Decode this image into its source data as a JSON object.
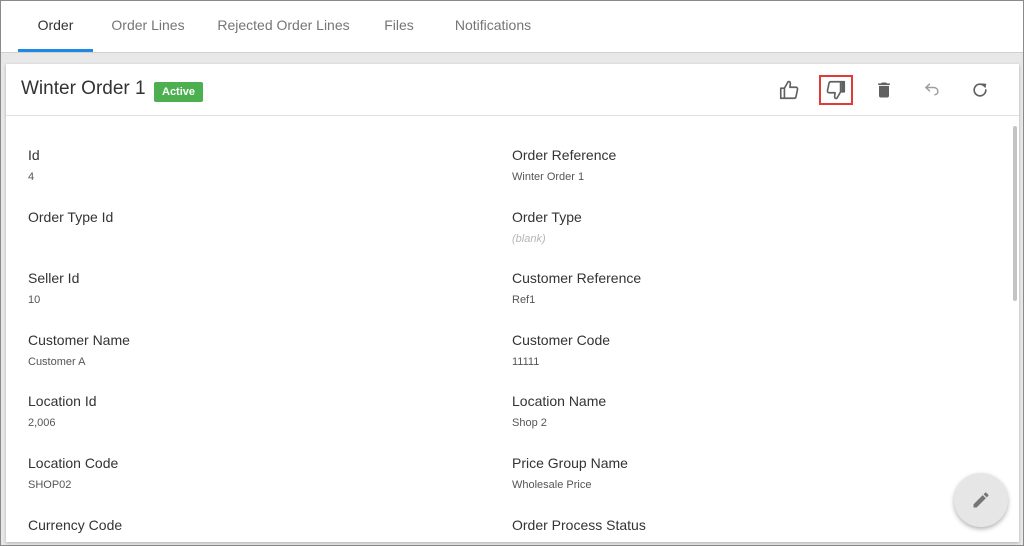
{
  "tabs": [
    {
      "label": "Order"
    },
    {
      "label": "Order Lines"
    },
    {
      "label": "Rejected Order Lines"
    },
    {
      "label": "Files"
    },
    {
      "label": "Notifications"
    }
  ],
  "record": {
    "title": "Winter Order 1",
    "status": "Active"
  },
  "actions": [
    "approve-icon",
    "reject-icon",
    "delete-icon",
    "undo-icon",
    "refresh-icon"
  ],
  "fields": [
    {
      "label": "Id",
      "value": "4"
    },
    {
      "label": "Order Reference",
      "value": "Winter Order 1"
    },
    {
      "label": "Order Type Id",
      "value": ""
    },
    {
      "label": "Order Type",
      "value": "(blank)"
    },
    {
      "label": "Seller Id",
      "value": "10"
    },
    {
      "label": "Customer Reference",
      "value": "Ref1"
    },
    {
      "label": "Customer Name",
      "value": "Customer A"
    },
    {
      "label": "Customer Code",
      "value": "11111"
    },
    {
      "label": "Location Id",
      "value": "2,006"
    },
    {
      "label": "Location Name",
      "value": "Shop 2"
    },
    {
      "label": "Location Code",
      "value": "SHOP02"
    },
    {
      "label": "Price Group Name",
      "value": "Wholesale Price"
    },
    {
      "label": "Currency Code",
      "value": ""
    },
    {
      "label": "Order Process Status",
      "value": ""
    }
  ],
  "colors": {
    "accent": "#1e88e5",
    "status_active": "#4caf50",
    "highlight": "#e53935"
  },
  "fab_icon": "edit-pencil-icon"
}
